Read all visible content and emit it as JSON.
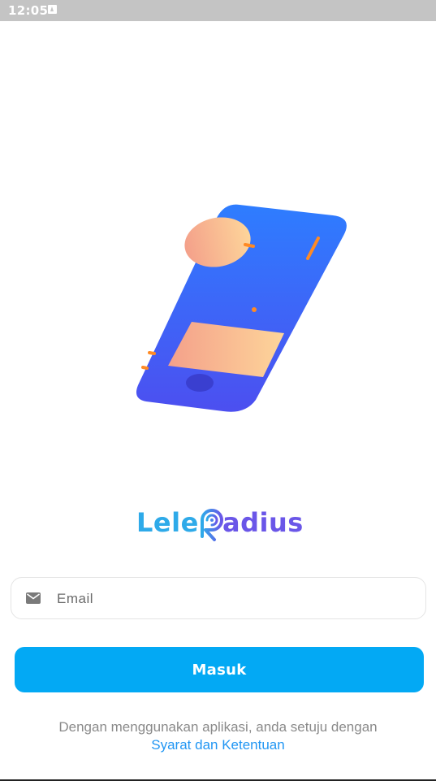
{
  "status_bar": {
    "time": "12:05"
  },
  "logo": {
    "part1": "Lele",
    "part2": "adius"
  },
  "email": {
    "placeholder": "Email",
    "value": ""
  },
  "login_button": {
    "label": "Masuk"
  },
  "terms": {
    "text": "Dengan menggunakan aplikasi, anda setuju dengan",
    "link": "Syarat dan Ketentuan"
  },
  "icons": {
    "status_notification": "notification-icon",
    "email": "mail-icon",
    "logo_mark": "radar-signal-icon"
  },
  "colors": {
    "primary": "#03a9f4",
    "link": "#2196f3",
    "logo_blue": "#2eaae9",
    "logo_purple": "#6a56e8",
    "status_bar": "#c4c4c4"
  }
}
